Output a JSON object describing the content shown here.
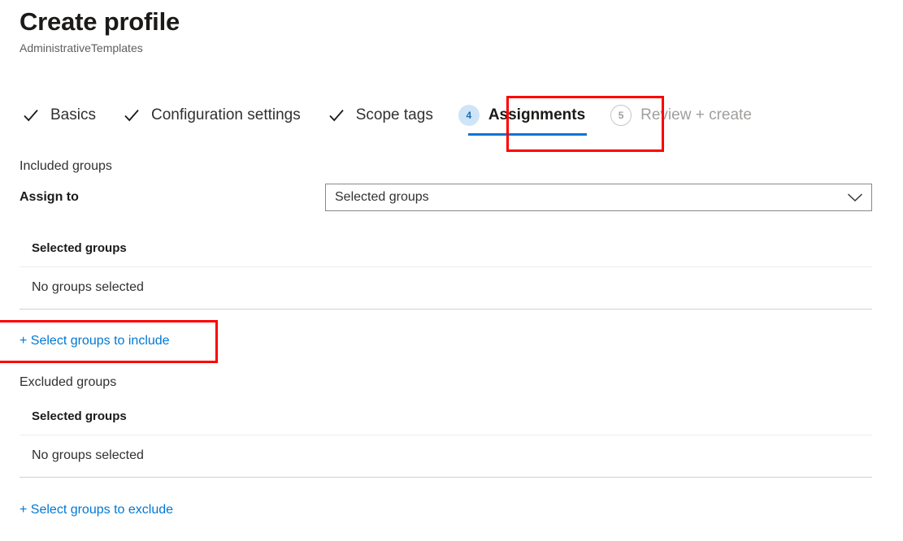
{
  "header": {
    "title": "Create profile",
    "subtitle": "AdministrativeTemplates"
  },
  "wizard": {
    "steps": [
      {
        "label": "Basics",
        "marker": "check-icon",
        "state": "complete",
        "number": ""
      },
      {
        "label": "Configuration settings",
        "marker": "check-icon",
        "state": "complete",
        "number": ""
      },
      {
        "label": "Scope tags",
        "marker": "check-icon",
        "state": "complete",
        "number": ""
      },
      {
        "label": "Assignments",
        "marker": "number-badge",
        "state": "active",
        "number": "4"
      },
      {
        "label": "Review + create",
        "marker": "number-badge",
        "state": "disabled",
        "number": "5"
      }
    ]
  },
  "included": {
    "heading": "Included groups",
    "assign_to_label": "Assign to",
    "assign_to_value": "Selected groups",
    "assign_to_placeholder": "Selected groups",
    "table": {
      "header": "Selected groups",
      "rows": [
        "No groups selected"
      ]
    },
    "action_link": "+ Select groups to include"
  },
  "excluded": {
    "heading": "Excluded groups",
    "table": {
      "header": "Selected groups",
      "rows": [
        "No groups selected"
      ]
    },
    "action_link": "+ Select groups to exclude"
  },
  "colors": {
    "accent": "#0078d4",
    "annotation": "#ff0000",
    "active_badge_bg": "#cfe4f7",
    "active_badge_fg": "#1f6fb2",
    "text_primary": "#323130",
    "text_secondary": "#605e5c",
    "text_disabled": "#a19f9d"
  }
}
